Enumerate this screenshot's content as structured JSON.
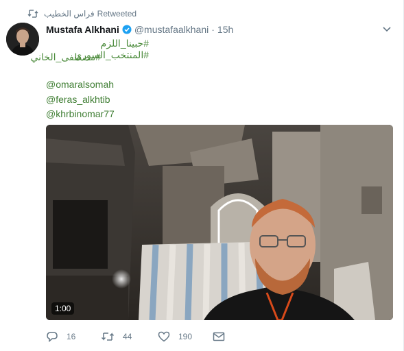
{
  "retweet": {
    "name": "فراس الخطيب",
    "label": "Retweeted"
  },
  "author": {
    "fullname": "Mustafa Alkhani",
    "handle": "@mustafaalkhani",
    "separator": "·",
    "time": "15h"
  },
  "body": {
    "hashtags_line1": "#حبينا_اللزم #المنتخب_السوري",
    "hashtags_line2": "#مصطفى_الخاني",
    "mentions": [
      "@omaralsomah",
      "@feras_alkhtib",
      "@khrbinomar77"
    ]
  },
  "media": {
    "duration": "1:00"
  },
  "actions": {
    "replies": "16",
    "retweets": "44",
    "likes": "190"
  },
  "colors": {
    "link_green": "#3e7d32",
    "meta_gray": "#657786",
    "verified_blue": "#1da1f2"
  },
  "icons": [
    "retweet-icon",
    "verified-icon",
    "caret-down-icon",
    "reply-icon",
    "retweet-action-icon",
    "heart-icon",
    "mail-icon"
  ]
}
